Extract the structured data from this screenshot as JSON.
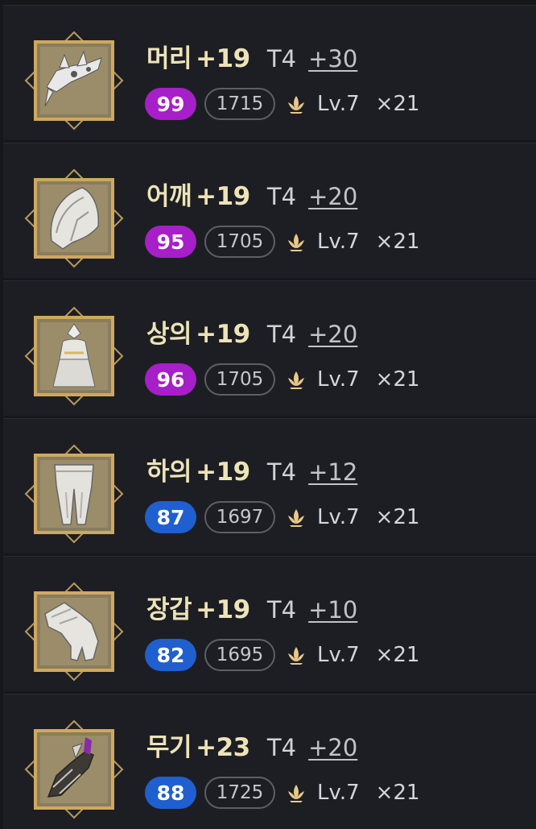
{
  "colors": {
    "purple_badge": "#a61fc8",
    "blue_badge": "#1f5fd0",
    "name": "#ece3b8"
  },
  "items": [
    {
      "slot": "머리",
      "upgrade": "+19",
      "tier": "T4",
      "refine": "+30",
      "quality": "99",
      "quality_color": "#a61fc8",
      "item_level": "1715",
      "elixir_level": "Lv.7",
      "count": "×21",
      "icon": "helmet-icon"
    },
    {
      "slot": "어깨",
      "upgrade": "+19",
      "tier": "T4",
      "refine": "+20",
      "quality": "95",
      "quality_color": "#a61fc8",
      "item_level": "1705",
      "elixir_level": "Lv.7",
      "count": "×21",
      "icon": "shoulder-icon"
    },
    {
      "slot": "상의",
      "upgrade": "+19",
      "tier": "T4",
      "refine": "+20",
      "quality": "96",
      "quality_color": "#a61fc8",
      "item_level": "1705",
      "elixir_level": "Lv.7",
      "count": "×21",
      "icon": "chest-icon"
    },
    {
      "slot": "하의",
      "upgrade": "+19",
      "tier": "T4",
      "refine": "+12",
      "quality": "87",
      "quality_color": "#1f5fd0",
      "item_level": "1697",
      "elixir_level": "Lv.7",
      "count": "×21",
      "icon": "pants-icon"
    },
    {
      "slot": "장갑",
      "upgrade": "+19",
      "tier": "T4",
      "refine": "+10",
      "quality": "82",
      "quality_color": "#1f5fd0",
      "item_level": "1695",
      "elixir_level": "Lv.7",
      "count": "×21",
      "icon": "gloves-icon"
    },
    {
      "slot": "무기",
      "upgrade": "+23",
      "tier": "T4",
      "refine": "+20",
      "quality": "88",
      "quality_color": "#1f5fd0",
      "item_level": "1725",
      "elixir_level": "Lv.7",
      "count": "×21",
      "icon": "weapon-icon"
    }
  ]
}
